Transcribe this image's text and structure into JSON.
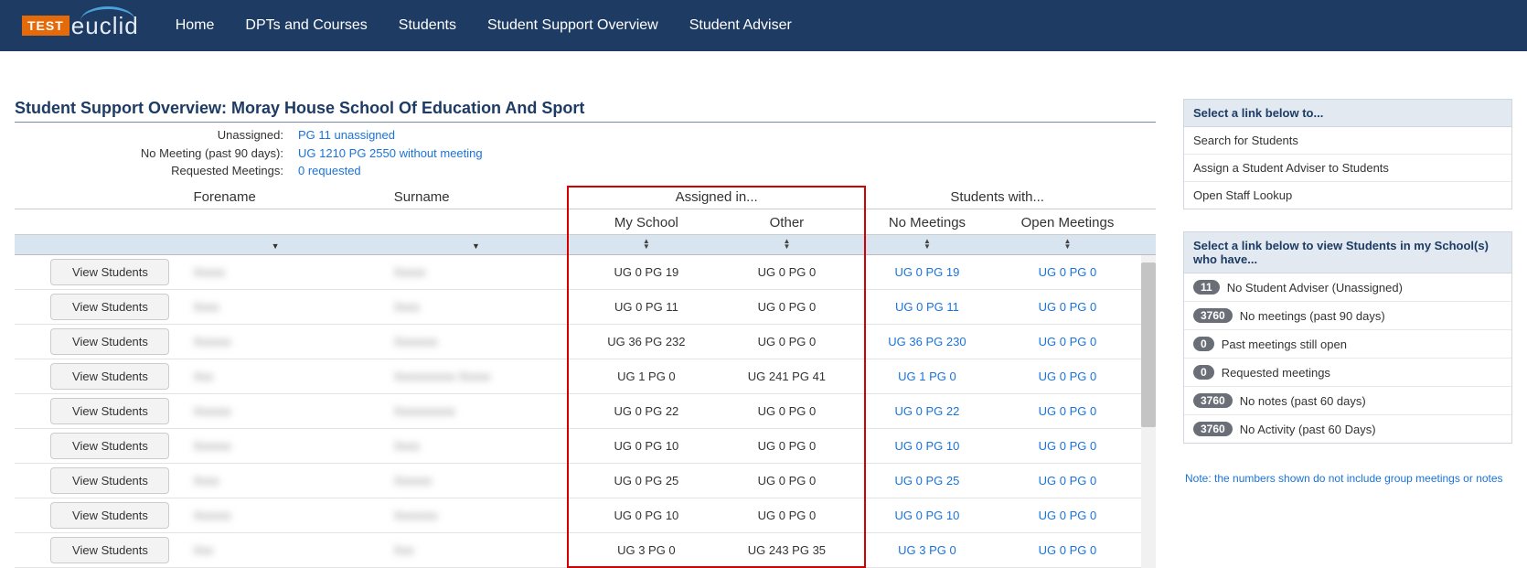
{
  "logo": {
    "test": "TEST",
    "name": "euclid"
  },
  "nav": [
    "Home",
    "DPTs and Courses",
    "Students",
    "Student Support Overview",
    "Student Adviser"
  ],
  "page_title": "Student Support Overview: Moray House School Of Education And Sport",
  "summary": {
    "unassigned_label": "Unassigned:",
    "unassigned_val": "PG 11 unassigned",
    "no_meeting_label": "No Meeting (past 90 days):",
    "no_meeting_val": "UG 1210 PG 2550 without meeting",
    "requested_label": "Requested Meetings:",
    "requested_val": "0 requested"
  },
  "headers": {
    "forename": "Forename",
    "surname": "Surname",
    "assigned_in": "Assigned in...",
    "my_school": "My School",
    "other": "Other",
    "students_with": "Students with...",
    "no_meetings": "No Meetings",
    "open_meetings": "Open Meetings"
  },
  "view_btn": "View Students",
  "rows": [
    {
      "forename": "Xxxxx",
      "surname": "Xxxxx",
      "my": "UG 0 PG 19",
      "other": "UG 0 PG 0",
      "no": "UG 0 PG 19",
      "open": "UG 0 PG 0"
    },
    {
      "forename": "Xxxx",
      "surname": "Xxxx",
      "my": "UG 0 PG 11",
      "other": "UG 0 PG 0",
      "no": "UG 0 PG 11",
      "open": "UG 0 PG 0"
    },
    {
      "forename": "Xxxxxx",
      "surname": "Xxxxxxx",
      "my": "UG 36 PG 232",
      "other": "UG 0 PG 0",
      "no": "UG 36 PG 230",
      "open": "UG 0 PG 0"
    },
    {
      "forename": "Xxx",
      "surname": "Xxxxxxxxxx Xxxxx",
      "my": "UG 1 PG 0",
      "other": "UG 241 PG 41",
      "no": "UG 1 PG 0",
      "open": "UG 0 PG 0"
    },
    {
      "forename": "Xxxxxx",
      "surname": "Xxxxxxxxxx",
      "my": "UG 0 PG 22",
      "other": "UG 0 PG 0",
      "no": "UG 0 PG 22",
      "open": "UG 0 PG 0"
    },
    {
      "forename": "Xxxxxx",
      "surname": "Xxxx",
      "my": "UG 0 PG 10",
      "other": "UG 0 PG 0",
      "no": "UG 0 PG 10",
      "open": "UG 0 PG 0"
    },
    {
      "forename": "Xxxx",
      "surname": "Xxxxxx",
      "my": "UG 0 PG 25",
      "other": "UG 0 PG 0",
      "no": "UG 0 PG 25",
      "open": "UG 0 PG 0"
    },
    {
      "forename": "Xxxxxx",
      "surname": "Xxxxxxx",
      "my": "UG 0 PG 10",
      "other": "UG 0 PG 0",
      "no": "UG 0 PG 10",
      "open": "UG 0 PG 0"
    },
    {
      "forename": "Xxx",
      "surname": "Xxx",
      "my": "UG 3 PG 0",
      "other": "UG 243 PG 35",
      "no": "UG 3 PG 0",
      "open": "UG 0 PG 0"
    }
  ],
  "panel1": {
    "title": "Select a link below to...",
    "items": [
      "Search for Students",
      "Assign a Student Adviser to Students",
      "Open Staff Lookup"
    ]
  },
  "panel2": {
    "title": "Select a link below to view Students in my School(s) who have...",
    "items": [
      {
        "count": "11",
        "label": "No Student Adviser (Unassigned)"
      },
      {
        "count": "3760",
        "label": "No meetings (past 90 days)"
      },
      {
        "count": "0",
        "label": "Past meetings still open"
      },
      {
        "count": "0",
        "label": "Requested meetings"
      },
      {
        "count": "3760",
        "label": "No notes (past 60 days)"
      },
      {
        "count": "3760",
        "label": "No Activity (past 60 Days)"
      }
    ],
    "note": "Note: the numbers shown do not include group meetings or notes"
  }
}
